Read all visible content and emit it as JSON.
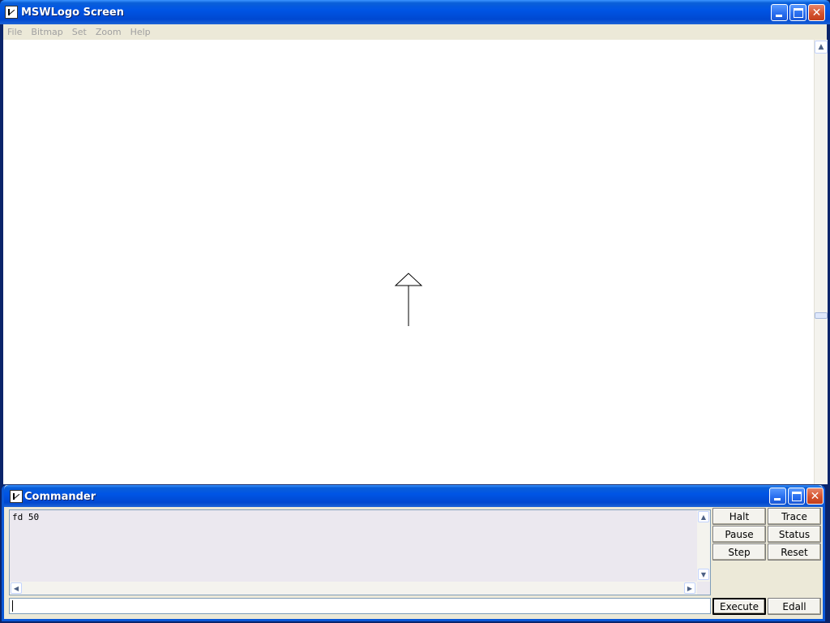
{
  "main_window": {
    "title": "MSWLogo Screen",
    "menu": [
      "File",
      "Bitmap",
      "Set",
      "Zoom",
      "Help"
    ],
    "caption_buttons": {
      "minimize": "minimize-icon",
      "maximize": "maximize-icon",
      "close": "close-icon"
    }
  },
  "canvas": {
    "turtle_icon": "turtle-arrow-icon",
    "line_color": "#000000",
    "scroll_up": "▲"
  },
  "commander": {
    "title": "Commander",
    "history": "fd 50",
    "buttons": {
      "halt": "Halt",
      "trace": "Trace",
      "pause": "Pause",
      "status": "Status",
      "step": "Step",
      "reset": "Reset",
      "execute": "Execute",
      "edall": "Edall"
    },
    "input_value": ""
  },
  "colors": {
    "title_bar": "#0055e5",
    "close_button": "#d4532f",
    "window_face": "#ece9d8"
  }
}
